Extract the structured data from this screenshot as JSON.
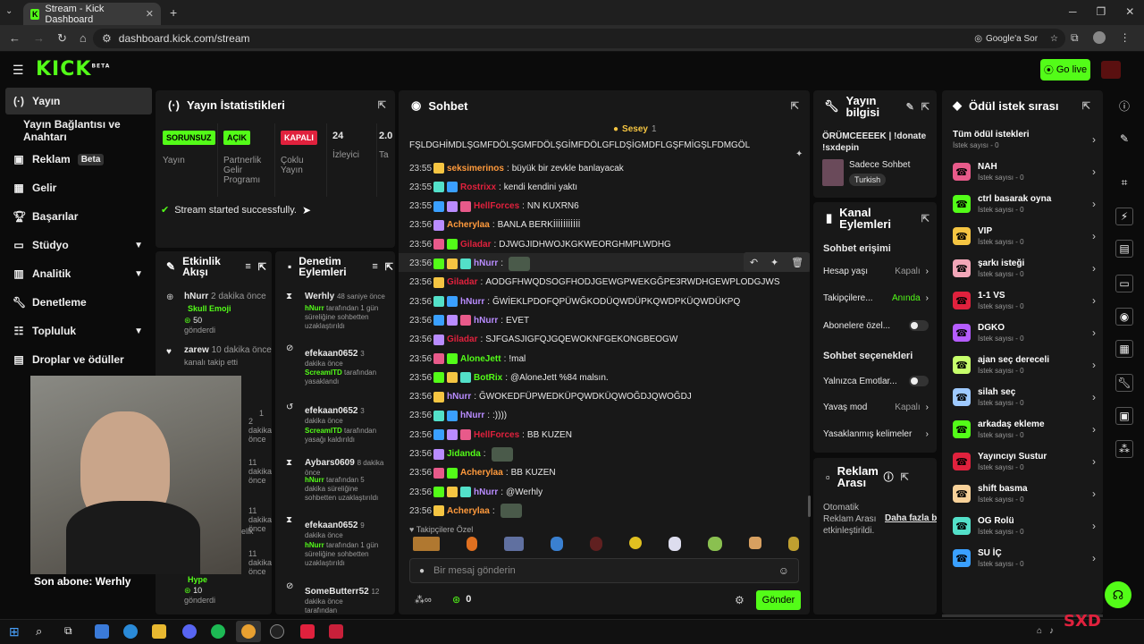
{
  "browser": {
    "tab_title": "Stream - Kick Dashboard",
    "url": "dashboard.kick.com/stream",
    "google_label": "Google'a Sor"
  },
  "header": {
    "logo": "KICK",
    "logo_beta": "BETA",
    "golive": "Go live"
  },
  "sidebar": {
    "items": [
      {
        "label": "Yayın",
        "icon": "broadcast-icon"
      },
      {
        "label": "Yayın Bağlantısı ve Anahtarı"
      },
      {
        "label": "Reklam",
        "badge": "Beta",
        "icon": "megaphone-icon"
      },
      {
        "label": "Gelir",
        "icon": "chart-icon"
      },
      {
        "label": "Başarılar",
        "icon": "trophy-icon"
      },
      {
        "label": "Stüdyo",
        "icon": "studio-icon"
      },
      {
        "label": "Analitik",
        "icon": "analytics-icon"
      },
      {
        "label": "Denetleme",
        "icon": "wrench-icon"
      },
      {
        "label": "Topluluk",
        "icon": "community-icon"
      },
      {
        "label": "Droplar ve ödüller",
        "icon": "gift-icon"
      }
    ]
  },
  "stats": {
    "title": "Yayın İstatistikleri",
    "cards": [
      {
        "tag": "SORUNSUZ",
        "label": "Yayın",
        "color": "#53fc18"
      },
      {
        "tag": "AÇIK",
        "label": "Partnerlik Gelir Programı",
        "color": "#53fc18"
      },
      {
        "tag": "KAPALI",
        "label": "Çoklu Yayın",
        "color": "#e0213d"
      },
      {
        "tag": "24",
        "label": "İzleyici",
        "color": ""
      },
      {
        "tag": "2.0",
        "label": "Ta",
        "color": ""
      }
    ],
    "toast": "Stream started successfully."
  },
  "activity": {
    "title": "Etkinlik Akışı",
    "items": [
      {
        "user": "hNurr",
        "time": "2 dakika önce",
        "sub": "Skull Emoji",
        "count": "50",
        "count_label": "gönderdi"
      },
      {
        "user": "zarew",
        "time": "10 dakika önce",
        "sub": "kanalı takip etti"
      },
      {
        "time": "1"
      },
      {
        "time": "2 dakika önce"
      },
      {
        "time": "11 dakika önce"
      },
      {
        "time": "11 dakika önce"
      },
      {
        "time": "elik"
      },
      {
        "time": "11 dakika önce"
      },
      {
        "sub": "Hype",
        "count": "10",
        "count_label": "gönderdi"
      }
    ]
  },
  "webcam": {
    "caption": "Son abone: Werhly"
  },
  "mod": {
    "title": "Denetim Eylemleri",
    "items": [
      {
        "user": "Werhly",
        "time": "48 saniye önce",
        "who": "hNurr",
        "desc": "tarafından 1 gün süreliğine sohbetten uzaklaştırıldı"
      },
      {
        "user": "efekaan0652",
        "time": "3 dakika önce",
        "who": "ScreamITD",
        "desc": "tarafından yasaklandı"
      },
      {
        "user": "efekaan0652",
        "time": "3 dakika önce",
        "who": "ScreamITD",
        "desc": "tarafından yasağı kaldırıldı"
      },
      {
        "user": "Aybars0609",
        "time": "8 dakika önce",
        "who": "hNurr",
        "desc": "tarafından 5 dakika süreliğine sohbetten uzaklaştırıldı"
      },
      {
        "user": "efekaan0652",
        "time": "9 dakika önce",
        "who": "hNurr",
        "desc": "tarafından 1 gün süreliğine sohbetten uzaklaştırıldı"
      },
      {
        "user": "SomeButterr52",
        "time": "12 dakika önce",
        "who": "",
        "desc": "tarafından"
      }
    ]
  },
  "chat": {
    "title": "Sohbet",
    "pinned_user": "Sesey",
    "pinned_count": "1",
    "first_line": "FŞLDGHİMDLŞGMFDÖLŞGMFDÖLŞGİMFDÖLGFLDŞİGMDFLGŞFMİGŞLFDMGÖL",
    "messages": [
      {
        "time": "23:55",
        "user": "seksimerinos",
        "color": "#ff9a3c",
        "text": "büyük bir zevkle banlayacak"
      },
      {
        "time": "23:55",
        "user": "Rostrixx",
        "color": "#e0213d",
        "text": "kendi kendini yaktı"
      },
      {
        "time": "23:55",
        "user": "HellForces",
        "color": "#e0213d",
        "text": "NN KUXRN6"
      },
      {
        "time": "23:56",
        "user": "Acherylaa",
        "color": "#ff9a3c",
        "text": "BANLA BERKİİİİİİİİİİİ"
      },
      {
        "time": "23:56",
        "user": "Giladar",
        "color": "#e0213d",
        "text": "DJWGJIDHWOJKGKWEORGHMPLWDHG"
      },
      {
        "time": "23:56",
        "user": "hNurr",
        "color": "#b98cff",
        "text": ""
      },
      {
        "time": "23:56",
        "user": "Giladar",
        "color": "#e0213d",
        "text": "AODGFHWQDSOGFHODJGEWGPWEKGĞPE3RWDHGEWPLODGJWS"
      },
      {
        "time": "23:56",
        "user": "hNurr",
        "color": "#b98cff",
        "text": "ĞWİEKLPDOFQPÜWĞKODÜQWDÜPKQWDPKÜQWDÜKPQ"
      },
      {
        "time": "23:56",
        "user": "hNurr",
        "color": "#b98cff",
        "text": "EVET"
      },
      {
        "time": "23:56",
        "user": "Giladar",
        "color": "#e0213d",
        "text": "SJFGASJIGFQJGQEWOKNFGEKONGBEOGW"
      },
      {
        "time": "23:56",
        "user": "AloneJett",
        "color": "#53fc18",
        "text": "!mal"
      },
      {
        "time": "23:56",
        "user": "BotRix",
        "color": "#53fc18",
        "text": "@AloneJett %84 malsın."
      },
      {
        "time": "23:56",
        "user": "hNurr",
        "color": "#b98cff",
        "text": "ĞWOKEDFÜPWEDKÜPQWDKÜQWOĞDJQWOĞDJ"
      },
      {
        "time": "23:56",
        "user": "hNurr",
        "color": "#b98cff",
        "text": ":))))"
      },
      {
        "time": "23:56",
        "user": "HellForces",
        "color": "#e0213d",
        "text": "BB KUZEN"
      },
      {
        "time": "23:56",
        "user": "Jidanda",
        "color": "#53fc18",
        "text": ""
      },
      {
        "time": "23:56",
        "user": "Acherylaa",
        "color": "#ff9a3c",
        "text": "BB KUZEN"
      },
      {
        "time": "23:56",
        "user": "hNurr",
        "color": "#b98cff",
        "text": "@Werhly"
      },
      {
        "time": "23:56",
        "user": "Acherylaa",
        "color": "#ff9a3c",
        "text": ""
      }
    ],
    "followers_label": "Takipçilere Özel",
    "input_placeholder": "Bir mesaj gönderin",
    "points": "0",
    "send": "Gönder"
  },
  "info": {
    "title": "Yayın bilgisi",
    "stream_title": "ÖRÜMCEEEEK | !donate !sxdepin",
    "category": "Sadece Sohbet",
    "language": "Turkish"
  },
  "channel": {
    "title": "Kanal Eylemleri",
    "access_title": "Sohbet erişimi",
    "rows": [
      {
        "label": "Hesap yaşı",
        "value": "Kapalı"
      },
      {
        "label": "Takipçilere...",
        "value": "Anında"
      },
      {
        "label": "Abonelere özel...",
        "value": ""
      }
    ],
    "options_title": "Sohbet seçenekleri",
    "options": [
      {
        "label": "Yalnızca Emotlar...",
        "value": ""
      },
      {
        "label": "Yavaş mod",
        "value": "Kapalı"
      },
      {
        "label": "Yasaklanmış kelimeler",
        "value": ""
      }
    ]
  },
  "ads": {
    "title": "Reklam Arası",
    "text": "Otomatik Reklam Arası etkinleştirildi.",
    "link": "Daha fazla bil"
  },
  "rewards": {
    "title": "Ödül istek sırası",
    "all_title": "Tüm ödül istekleri",
    "all_sub": "İstek sayısı - 0",
    "items": [
      {
        "name": "NAH",
        "color": "#e85a8a"
      },
      {
        "name": "ctrl basarak oyna",
        "color": "#53fc18"
      },
      {
        "name": "VIP",
        "color": "#f5c542"
      },
      {
        "name": "şarkı isteği",
        "color": "#f2a6b8"
      },
      {
        "name": "1-1 VS",
        "color": "#e0213d"
      },
      {
        "name": "DGKO",
        "color": "#b55cff"
      },
      {
        "name": "ajan seç dereceli",
        "color": "#c7ff6b"
      },
      {
        "name": "silah seç",
        "color": "#9ec9ff"
      },
      {
        "name": "arkadaş ekleme",
        "color": "#53fc18"
      },
      {
        "name": "Yayıncıyı Sustur",
        "color": "#e0213d"
      },
      {
        "name": "shift basma",
        "color": "#f7d199"
      },
      {
        "name": "OG Rolü",
        "color": "#53e0c9"
      },
      {
        "name": "SU İÇ",
        "color": "#3aa0ff"
      }
    ],
    "sub": "İstek sayısı - 0"
  }
}
